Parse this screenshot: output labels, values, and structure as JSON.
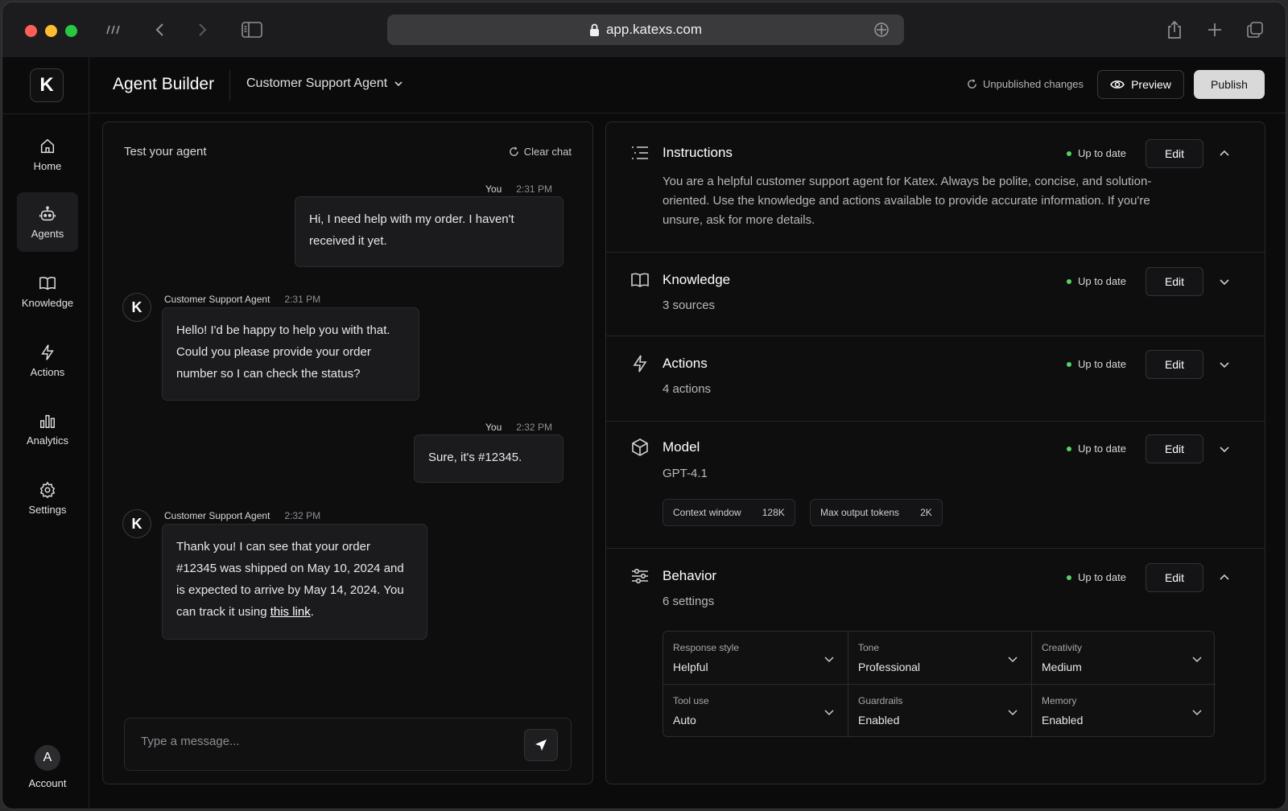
{
  "browser": {
    "url": "app.katexs.com"
  },
  "app": {
    "logo": "K",
    "title": "Agent Builder",
    "agent_name": "Customer Support Agent",
    "unpublished": "Unpublished changes",
    "preview_label": "Preview",
    "publish_label": "Publish"
  },
  "sidebar": {
    "items": [
      {
        "label": "Home",
        "icon": "home-icon"
      },
      {
        "label": "Agents",
        "icon": "robot-icon"
      },
      {
        "label": "Knowledge",
        "icon": "book-icon"
      },
      {
        "label": "Actions",
        "icon": "bolt-icon"
      },
      {
        "label": "Analytics",
        "icon": "bar-chart-icon"
      },
      {
        "label": "Settings",
        "icon": "gear-icon"
      }
    ],
    "account_initial": "A",
    "account_label": "Account"
  },
  "chat": {
    "title": "Test your agent",
    "clear_label": "Clear chat",
    "messages": [
      {
        "sender": "You",
        "time": "2:31 PM",
        "text": "Hi, I need help with my order. I haven't received it yet."
      },
      {
        "sender": "Customer Support Agent",
        "time": "2:31 PM",
        "text": "Hello! I'd be happy to help you with that. Could you please provide your order number so I can check the status?"
      },
      {
        "sender": "You",
        "time": "2:32 PM",
        "text": "Sure, it's #12345."
      },
      {
        "sender": "Customer Support Agent",
        "time": "2:32 PM",
        "text_before": "Thank you! I can see that your order #12345 was shipped on May 10, 2024 and is expected to arrive by May 14, 2024. You can track it using ",
        "link": "this link",
        "text_after": "."
      }
    ],
    "agent_avatar": "K",
    "placeholder": "Type a message..."
  },
  "config": {
    "status_label": "Up to date",
    "edit_label": "Edit",
    "instructions": {
      "title": "Instructions",
      "text": "You are a helpful customer support agent for Katex.  Always be polite, concise, and solution-oriented. Use the knowledge and actions available to provide accurate information.  If you're unsure, ask for more details."
    },
    "knowledge": {
      "title": "Knowledge",
      "sub": "3 sources"
    },
    "actions": {
      "title": "Actions",
      "sub": "4 actions"
    },
    "model": {
      "title": "Model",
      "sub": "GPT-4.1",
      "chips": [
        {
          "label": "Context window",
          "value": "128K"
        },
        {
          "label": "Max output tokens",
          "value": "2K"
        }
      ]
    },
    "behavior": {
      "title": "Behavior",
      "sub": "6 settings",
      "settings": [
        {
          "label": "Response style",
          "value": "Helpful"
        },
        {
          "label": "Tone",
          "value": "Professional"
        },
        {
          "label": "Creativity",
          "value": "Medium"
        },
        {
          "label": "Tool use",
          "value": "Auto"
        },
        {
          "label": "Guardrails",
          "value": "Enabled"
        },
        {
          "label": "Memory",
          "value": "Enabled"
        }
      ]
    }
  },
  "colors": {
    "status_dot": "#56d364",
    "publish_bg": "#d9d9d9",
    "close": "#ff5f57",
    "minimize": "#febc2e",
    "zoom": "#28c840"
  }
}
